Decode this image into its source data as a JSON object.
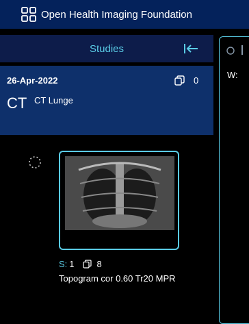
{
  "header": {
    "app_title": "Open Health Imaging Foundation"
  },
  "sidebar": {
    "studies_label": "Studies",
    "study": {
      "date": "26-Apr-2022",
      "instance_count": "0",
      "modality": "CT",
      "description": "CT Lunge"
    },
    "series": {
      "s_label": "S:",
      "s_number": "1",
      "instance_count": "8",
      "description": "Topogram cor 0.60 Tr20 MPR"
    }
  },
  "viewport": {
    "w_label": "W:"
  },
  "colors": {
    "accent": "#5acce6",
    "header_bg": "#04225b",
    "card_bg": "#0e306b"
  }
}
